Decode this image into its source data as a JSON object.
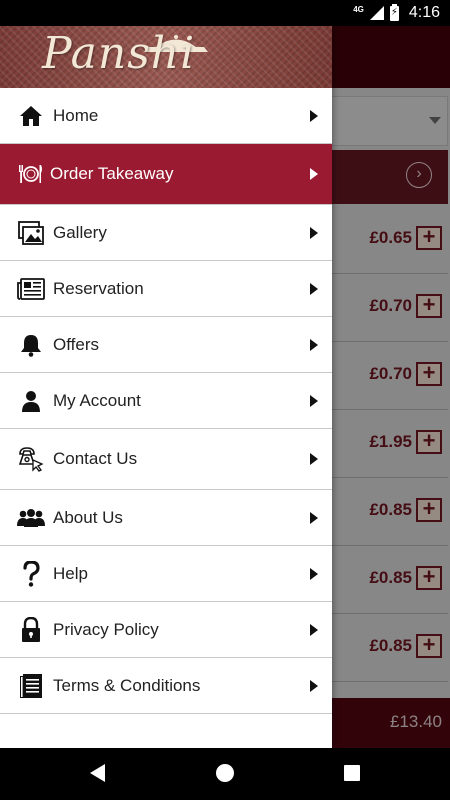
{
  "status_bar": {
    "network": "4G",
    "time": "4:16"
  },
  "drawer": {
    "logo_text": "Panshi",
    "items": [
      {
        "label": "Home",
        "icon": "home-icon"
      },
      {
        "label": "Order Takeaway",
        "icon": "plate-cutlery-icon",
        "active": true
      },
      {
        "label": "Gallery",
        "icon": "gallery-icon"
      },
      {
        "label": "Reservation",
        "icon": "newspaper-icon"
      },
      {
        "label": "Offers",
        "icon": "bell-icon"
      },
      {
        "label": "My Account",
        "icon": "user-icon"
      },
      {
        "label": "Contact Us",
        "icon": "phone-icon"
      },
      {
        "label": "About Us",
        "icon": "group-icon"
      },
      {
        "label": "Help",
        "icon": "question-icon"
      },
      {
        "label": "Privacy Policy",
        "icon": "lock-icon"
      },
      {
        "label": "Terms & Conditions",
        "icon": "document-icon"
      }
    ]
  },
  "background": {
    "prices": [
      "£0.65",
      "£0.70",
      "£0.70",
      "£1.95",
      "£0.85",
      "£0.85",
      "£0.85"
    ],
    "add_label": "+",
    "total": "£13.40"
  },
  "colors": {
    "accent": "#9a1b31",
    "header_dark": "#3e0109",
    "price": "#6b1420"
  }
}
